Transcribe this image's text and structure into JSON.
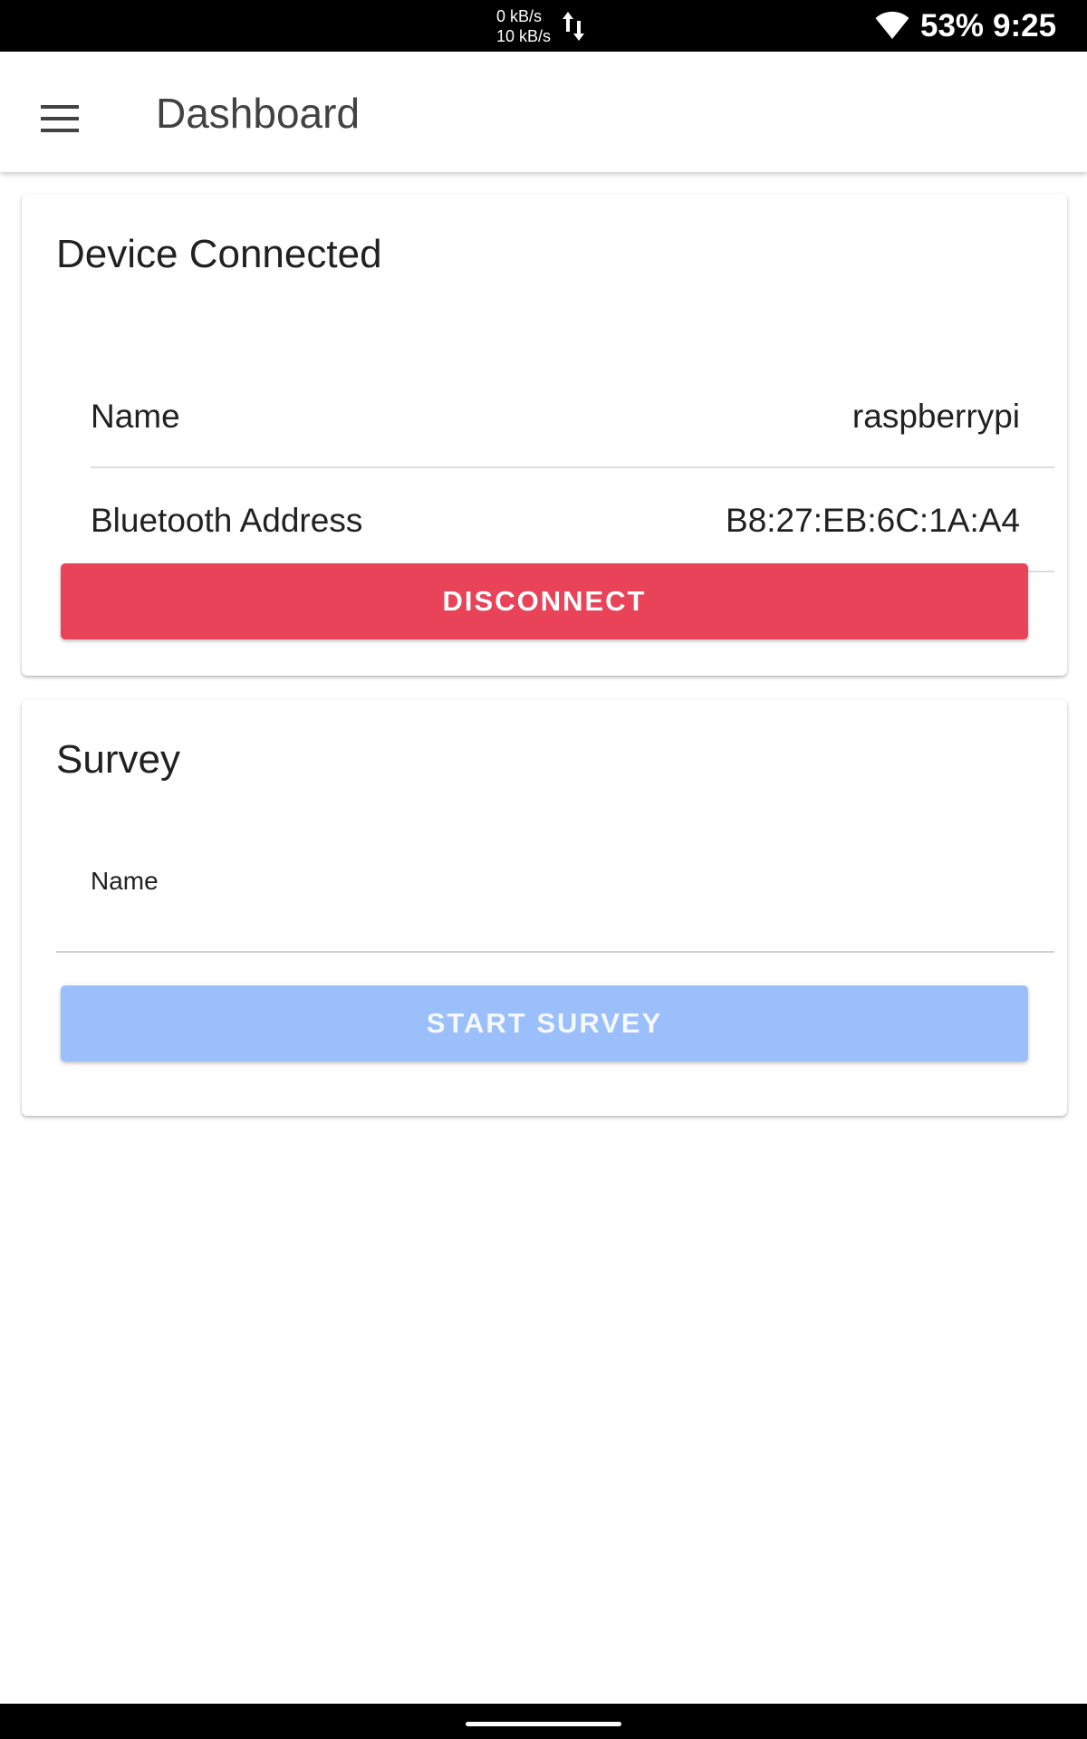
{
  "status_bar": {
    "net_up": "0 kB/s",
    "net_down": "10 kB/s",
    "battery": "53%",
    "time": "9:25",
    "icons": [
      "data-arrows-icon",
      "wifi-icon"
    ]
  },
  "app_bar": {
    "title": "Dashboard",
    "menu_icon": "hamburger-menu-icon"
  },
  "device_card": {
    "title": "Device Connected",
    "rows": [
      {
        "label": "Name",
        "value": "raspberrypi"
      },
      {
        "label": "Bluetooth Address",
        "value": "B8:27:EB:6C:1A:A4"
      }
    ],
    "disconnect_label": "DISCONNECT"
  },
  "survey_card": {
    "title": "Survey",
    "name_field_label": "Name",
    "name_field_value": "",
    "start_label": "START SURVEY"
  },
  "colors": {
    "disconnect": "#e9435a",
    "start_disabled": "#9bbffb",
    "status_bar": "#000000"
  }
}
